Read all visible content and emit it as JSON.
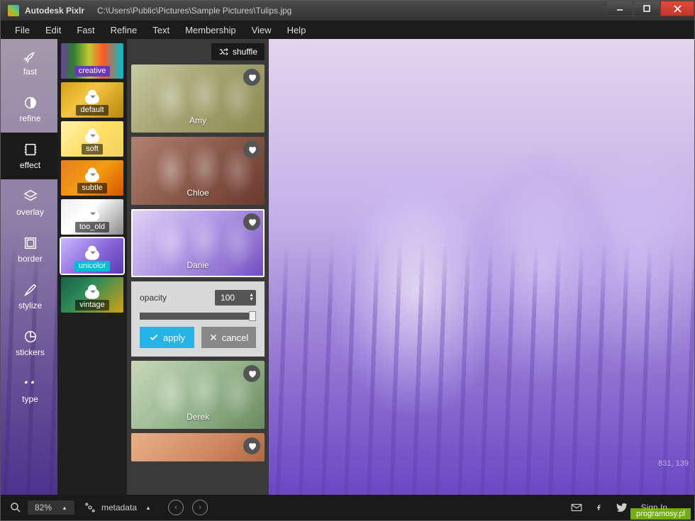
{
  "window": {
    "app_name": "Autodesk Pixlr",
    "file_path": "C:\\Users\\Public\\Pictures\\Sample Pictures\\Tulips.jpg"
  },
  "menu": [
    "File",
    "Edit",
    "Fast",
    "Refine",
    "Text",
    "Membership",
    "View",
    "Help"
  ],
  "tools": [
    {
      "id": "fast",
      "label": "fast"
    },
    {
      "id": "refine",
      "label": "refine"
    },
    {
      "id": "effect",
      "label": "effect"
    },
    {
      "id": "overlay",
      "label": "overlay"
    },
    {
      "id": "border",
      "label": "border"
    },
    {
      "id": "stylize",
      "label": "stylize"
    },
    {
      "id": "stickers",
      "label": "stickers"
    },
    {
      "id": "type",
      "label": "type"
    }
  ],
  "active_tool": "effect",
  "categories": [
    {
      "id": "creative",
      "label": "creative",
      "lbl_class": "purple"
    },
    {
      "id": "default",
      "label": "default"
    },
    {
      "id": "soft",
      "label": "soft"
    },
    {
      "id": "subtle",
      "label": "subtle"
    },
    {
      "id": "too_old",
      "label": "too_old"
    },
    {
      "id": "unicolor",
      "label": "unicolor",
      "lbl_class": "blue",
      "selected": true
    },
    {
      "id": "vintage",
      "label": "vintage"
    }
  ],
  "shuffle_label": "shuffle",
  "presets": [
    {
      "id": "amy",
      "label": "Amy",
      "g": "g-amy"
    },
    {
      "id": "chloe",
      "label": "Chloe",
      "g": "g-chloe"
    },
    {
      "id": "danie",
      "label": "Danie",
      "g": "g-danie",
      "selected": true
    },
    {
      "id": "derek",
      "label": "Derek",
      "g": "g-derek"
    },
    {
      "id": "next",
      "label": "",
      "g": "g-next"
    }
  ],
  "adjust": {
    "opacity_label": "opacity",
    "opacity_value": "100",
    "apply_label": "apply",
    "cancel_label": "cancel"
  },
  "status": {
    "zoom": "82%",
    "metadata_label": "metadata",
    "signin_label": "Sign In",
    "coords": "831, 139",
    "watermark": "programosy.pl"
  }
}
